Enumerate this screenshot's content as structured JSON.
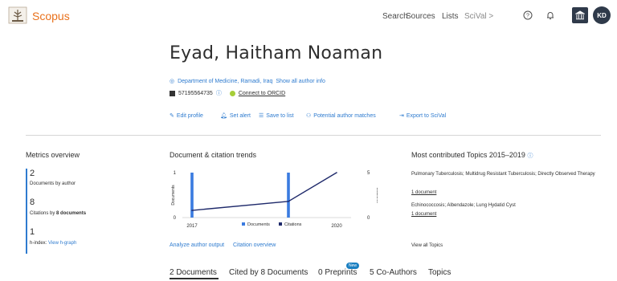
{
  "header": {
    "brand": "Scopus",
    "nav": {
      "search": "Search",
      "sources": "Sources",
      "lists": "Lists",
      "scival": "SciVal >"
    },
    "avatar_initials": "KD"
  },
  "profile": {
    "name": "Eyad, Haitham Noaman",
    "affiliation": "Department of Medicine, Ramadi, Iraq",
    "show_all_info": "Show all author info",
    "author_id": "57195564735",
    "orcid": "Connect to ORCID"
  },
  "actions": {
    "edit_profile": "Edit profile",
    "set_alert": "Set alert",
    "save_to_list": "Save to list",
    "potential_matches": "Potential author matches",
    "export_scival": "Export to SciVal"
  },
  "metrics": {
    "title": "Metrics overview",
    "documents_value": "2",
    "documents_label": "Documents by author",
    "citations_value": "8",
    "citations_label_prefix": "Citations by",
    "citations_label_bold": "8 documents",
    "hindex_value": "1",
    "hindex_label": "h-index:",
    "view_hgraph": "View h-graph"
  },
  "trends": {
    "title": "Document & citation trends",
    "analyze": "Analyze author output",
    "citation_overview": "Citation overview"
  },
  "chart_data": {
    "type": "bar",
    "categories": [
      "2017",
      "2020"
    ],
    "x_ticks": [
      "2017",
      "2020"
    ],
    "series": [
      {
        "name": "Documents",
        "type": "bar",
        "axis": "left",
        "x": [
          2017,
          2019
        ],
        "values": [
          1,
          1
        ]
      },
      {
        "name": "Citations",
        "type": "line",
        "axis": "right",
        "x": [
          2017,
          2019,
          2020
        ],
        "values": [
          0.8,
          1.8,
          5
        ]
      }
    ],
    "ylabel_left": "Documents",
    "ylabel_right": "Citations",
    "ylim_left": [
      0,
      1
    ],
    "ylim_right": [
      0,
      5
    ],
    "y_ticks_left": [
      "1",
      "0"
    ],
    "y_ticks_right": [
      "5",
      "0"
    ],
    "xlim": [
      2016.8,
      2020.3
    ],
    "legend": "bottom",
    "colors": {
      "bars": "#3a7be0",
      "line": "#1f2a6b"
    }
  },
  "topics": {
    "title": "Most contributed Topics 2015–2019",
    "topic1": "Pulmonary Tuberculosis; Multidrug Resistant Tuberculosis; Directly Observed Therapy",
    "topic1_count": "1 document",
    "topic2": "Echinococcosis; Albendazole; Lung Hydatid Cyst",
    "topic2_count": "1 document",
    "view_all": "View all Topics"
  },
  "tabs": {
    "documents": "2 Documents",
    "cited_by": "Cited by 8 Documents",
    "preprints": "0 Preprints",
    "new_badge": "New",
    "coauthors": "5 Co-Authors",
    "topics": "Topics"
  },
  "colors": {
    "accent": "#e9711c",
    "link": "#2e7bcf",
    "metric_bar": "#2e7bcf",
    "badge": "#1a7fc1"
  }
}
